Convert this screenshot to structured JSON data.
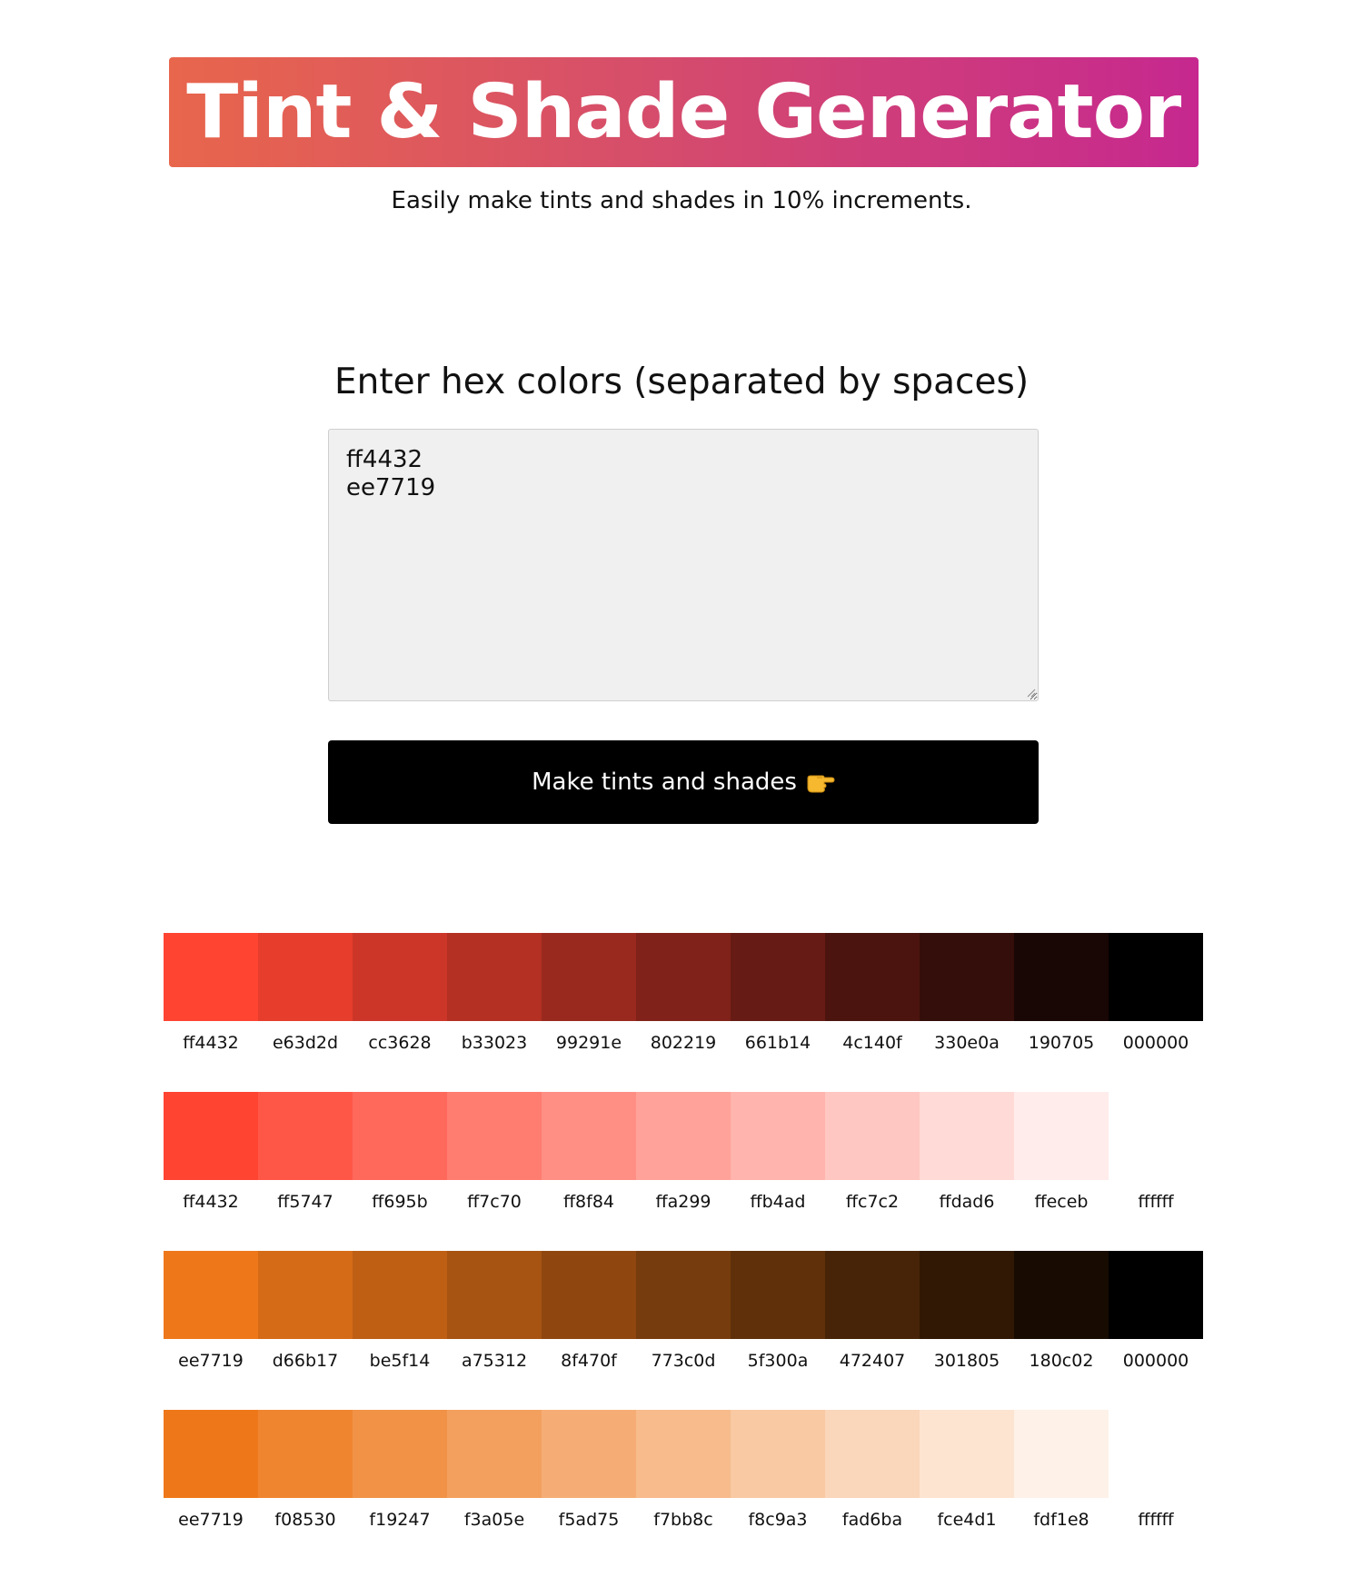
{
  "header": {
    "title": "Tint & Shade Generator",
    "subtitle": "Easily make tints and shades in 10% increments.",
    "gradient": [
      "#e8664c",
      "#d64e6a",
      "#c6288f"
    ]
  },
  "form": {
    "heading": "Enter hex colors (separated by spaces)",
    "input_value": "ff4432\nee7719",
    "button_label": "Make tints and shades",
    "button_icon": "pointing-hand-icon"
  },
  "palettes": [
    {
      "base": "ff4432",
      "kind": "shades",
      "swatches": [
        "ff4432",
        "e63d2d",
        "cc3628",
        "b33023",
        "99291e",
        "802219",
        "661b14",
        "4c140f",
        "330e0a",
        "190705",
        "000000"
      ]
    },
    {
      "base": "ff4432",
      "kind": "tints",
      "swatches": [
        "ff4432",
        "ff5747",
        "ff695b",
        "ff7c70",
        "ff8f84",
        "ffa299",
        "ffb4ad",
        "ffc7c2",
        "ffdad6",
        "ffeceb",
        "ffffff"
      ]
    },
    {
      "base": "ee7719",
      "kind": "shades",
      "swatches": [
        "ee7719",
        "d66b17",
        "be5f14",
        "a75312",
        "8f470f",
        "773c0d",
        "5f300a",
        "472407",
        "301805",
        "180c02",
        "000000"
      ]
    },
    {
      "base": "ee7719",
      "kind": "tints",
      "swatches": [
        "ee7719",
        "f08530",
        "f19247",
        "f3a05e",
        "f5ad75",
        "f7bb8c",
        "f8c9a3",
        "fad6ba",
        "fce4d1",
        "fdf1e8",
        "ffffff"
      ]
    }
  ]
}
